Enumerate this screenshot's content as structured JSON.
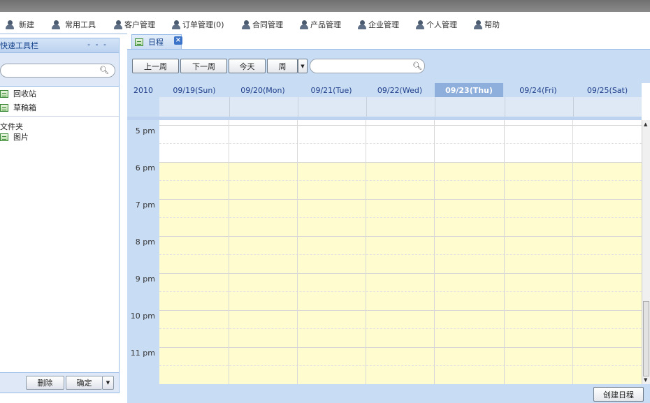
{
  "menu": {
    "items": [
      {
        "label": "新建"
      },
      {
        "label": "常用工具"
      },
      {
        "label": "客户管理"
      },
      {
        "label": "订单管理(0)"
      },
      {
        "label": "合同管理"
      },
      {
        "label": "产品管理"
      },
      {
        "label": "企业管理"
      },
      {
        "label": "个人管理"
      },
      {
        "label": "帮助"
      }
    ]
  },
  "left_panel": {
    "title": "快速工具栏",
    "collapse_dashes": "- - -",
    "search_placeholder": "",
    "items": [
      {
        "label": "回收站"
      },
      {
        "label": "草稿箱"
      }
    ],
    "folder_heading": "文件夹",
    "folder_items": [
      {
        "label": "图片"
      }
    ],
    "delete_label": "删除",
    "confirm_label": "确定"
  },
  "tab": {
    "label": "日程",
    "close_glyph": "×"
  },
  "toolbar": {
    "prev_week": "上一周",
    "next_week": "下一周",
    "today": "今天",
    "view": "周",
    "search_placeholder": ""
  },
  "calendar": {
    "year": "2010",
    "days": [
      {
        "label": "09/19(Sun)"
      },
      {
        "label": "09/20(Mon)"
      },
      {
        "label": "09/21(Tue)"
      },
      {
        "label": "09/22(Wed)"
      },
      {
        "label": "09/23(Thu)",
        "today": true
      },
      {
        "label": "09/24(Fri)"
      },
      {
        "label": "09/25(Sat)"
      }
    ],
    "hours": [
      "5 pm",
      "6 pm",
      "7 pm",
      "8 pm",
      "9 pm",
      "10 pm",
      "11 pm"
    ],
    "create_label": "创建日程"
  },
  "colors": {
    "accent": "#99bbe8",
    "today_header": "#8eaedb",
    "off_hours": "#fffccf",
    "panel_bg": "#c8dcf4"
  }
}
